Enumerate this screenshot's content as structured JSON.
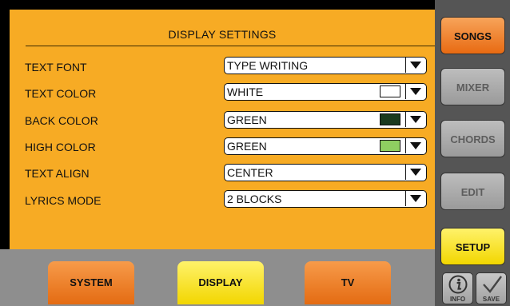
{
  "panel": {
    "title": "DISPLAY SETTINGS",
    "rows": [
      {
        "label": "TEXT FONT",
        "value": "TYPE WRITING"
      },
      {
        "label": "TEXT COLOR",
        "value": "WHITE",
        "swatch": "#ffffff"
      },
      {
        "label": "BACK COLOR",
        "value": "GREEN",
        "swatch": "#1b3a1e"
      },
      {
        "label": "HIGH COLOR",
        "value": "GREEN",
        "swatch": "#8fcf61"
      },
      {
        "label": "TEXT ALIGN",
        "value": "CENTER"
      },
      {
        "label": "LYRICS MODE",
        "value": "2 BLOCKS"
      }
    ]
  },
  "tabs": [
    {
      "label": "SYSTEM",
      "state": "inactive"
    },
    {
      "label": "DISPLAY",
      "state": "active"
    },
    {
      "label": "TV",
      "state": "inactive"
    }
  ],
  "sidebar": {
    "buttons": [
      {
        "label": "SONGS",
        "state": "orange"
      },
      {
        "label": "MIXER",
        "state": "gray"
      },
      {
        "label": "CHORDS",
        "state": "gray"
      },
      {
        "label": "EDIT",
        "state": "gray"
      },
      {
        "label": "SETUP",
        "state": "active"
      }
    ],
    "info_label": "INFO",
    "save_label": "SAVE"
  },
  "colors": {
    "panel": "#f7ab24",
    "active": "#f7e21a",
    "accent": "#ec7a22",
    "disabled": "#a8a8a8"
  },
  "icons": [
    "info-icon",
    "checkmark-icon",
    "dropdown-arrow-icon"
  ]
}
